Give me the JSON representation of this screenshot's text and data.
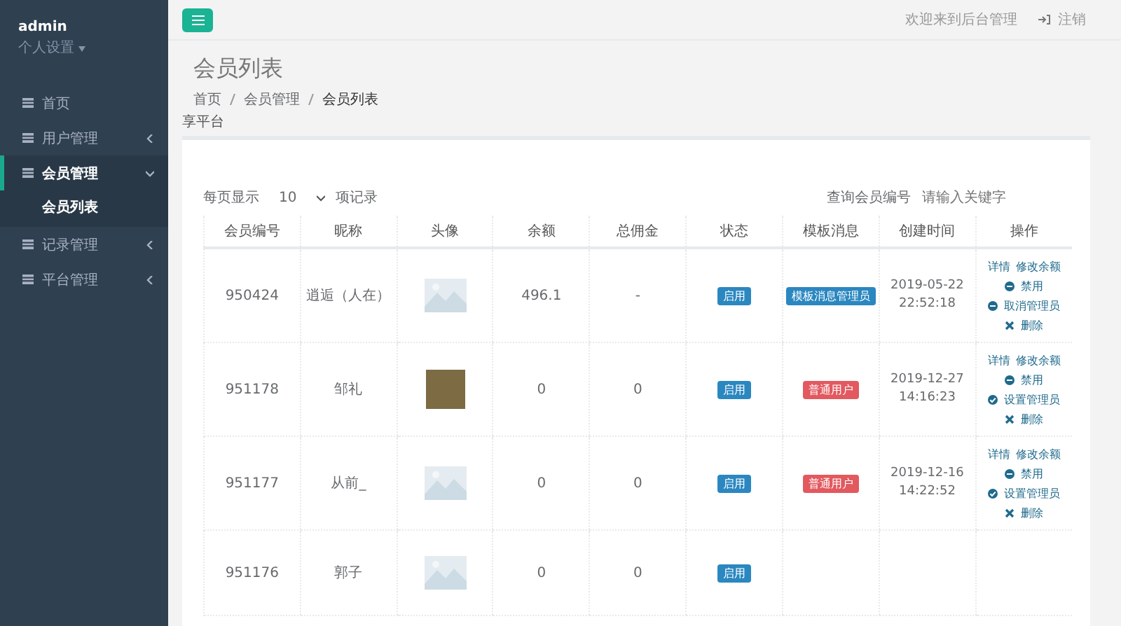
{
  "sidebar": {
    "user": {
      "name": "admin",
      "settings": "个人设置"
    },
    "items": [
      {
        "label": "首页",
        "selected": false
      },
      {
        "label": "用户管理",
        "selected": false,
        "expanded": false
      },
      {
        "label": "会员管理",
        "selected": true,
        "expanded": true,
        "children": [
          {
            "label": "会员列表",
            "selected": true
          }
        ]
      },
      {
        "label": "记录管理",
        "selected": false,
        "expanded": false
      },
      {
        "label": "平台管理",
        "selected": false,
        "expanded": false
      }
    ]
  },
  "topbar": {
    "welcome": "欢迎来到后台管理",
    "logout": "注销"
  },
  "page": {
    "title": "会员列表",
    "breadcrumb": [
      "首页",
      "会员管理",
      "会员列表"
    ],
    "ghost_text": "享平台"
  },
  "controls": {
    "page_size_label": "每页显示",
    "page_size": "10",
    "page_size_suffix": "项记录",
    "search_label": "查询会员编号",
    "search_placeholder": "请输入关键字"
  },
  "table": {
    "columns": [
      "会员编号",
      "昵称",
      "头像",
      "余额",
      "总佣金",
      "状态",
      "模板消息",
      "创建时间",
      "操作"
    ],
    "rows": [
      {
        "id": "950424",
        "nickname": "逍逅（人在）",
        "avatar": {
          "kind": "placeholder"
        },
        "balance": "496.1",
        "commission": "-",
        "status": "启用",
        "role": {
          "label": "模板消息管理员",
          "color": "#2b87c0"
        },
        "created": [
          "2019-05-22",
          "22:52:18"
        ],
        "actions": [
          {
            "kind": "link",
            "label": "详情"
          },
          {
            "kind": "link",
            "label": "修改余额"
          },
          {
            "kind": "minus",
            "label": "禁用"
          },
          {
            "kind": "minus",
            "label": "取消管理员"
          },
          {
            "kind": "cross",
            "label": "删除"
          }
        ]
      },
      {
        "id": "951178",
        "nickname": "邹礼",
        "avatar": {
          "kind": "photo"
        },
        "balance": "0",
        "commission": "0",
        "status": "启用",
        "role": {
          "label": "普通用户",
          "color": "#e2595f"
        },
        "created": [
          "2019-12-27",
          "14:16:23"
        ],
        "actions": [
          {
            "kind": "link",
            "label": "详情"
          },
          {
            "kind": "link",
            "label": "修改余额"
          },
          {
            "kind": "minus",
            "label": "禁用"
          },
          {
            "kind": "check",
            "label": "设置管理员"
          },
          {
            "kind": "cross",
            "label": "删除"
          }
        ]
      },
      {
        "id": "951177",
        "nickname": "从前_",
        "avatar": {
          "kind": "placeholder"
        },
        "balance": "0",
        "commission": "0",
        "status": "启用",
        "role": {
          "label": "普通用户",
          "color": "#e2595f"
        },
        "created": [
          "2019-12-16",
          "14:22:52"
        ],
        "actions": [
          {
            "kind": "link",
            "label": "详情"
          },
          {
            "kind": "link",
            "label": "修改余额"
          },
          {
            "kind": "minus",
            "label": "禁用"
          },
          {
            "kind": "check",
            "label": "设置管理员"
          },
          {
            "kind": "cross",
            "label": "删除"
          }
        ]
      },
      {
        "id": "951176",
        "nickname": "郭子",
        "avatar": {
          "kind": "placeholder"
        },
        "balance": "0",
        "commission": "0",
        "status": "启用"
      }
    ]
  }
}
